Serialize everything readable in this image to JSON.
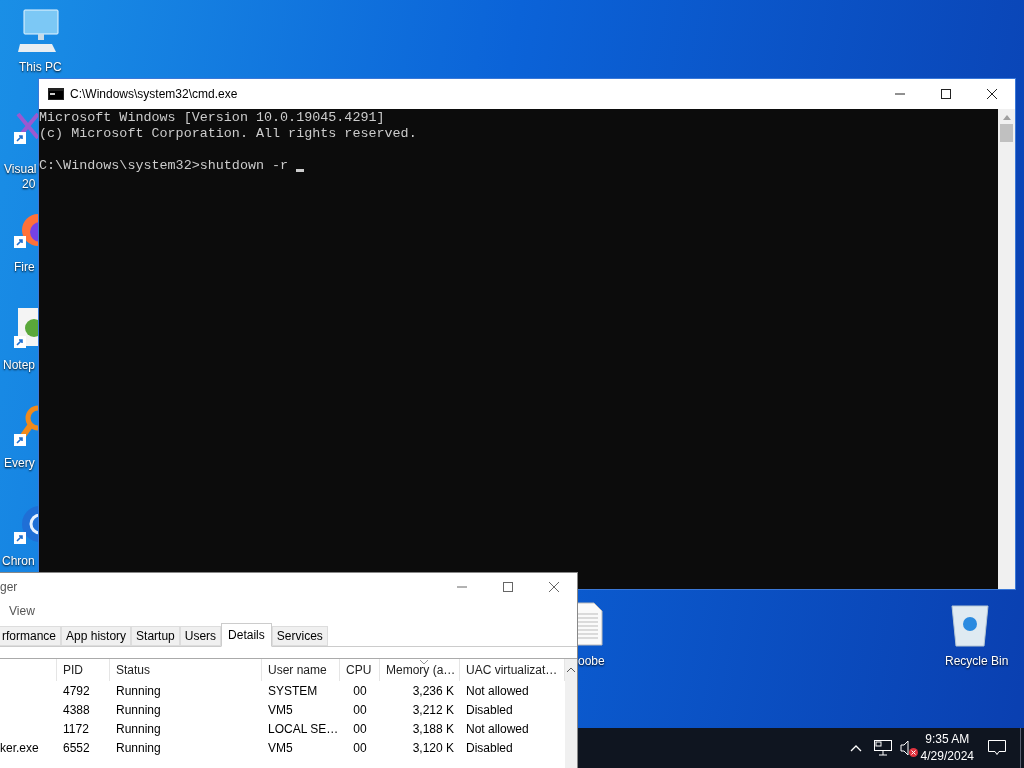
{
  "desktop": {
    "icons": [
      {
        "kind": "computer",
        "label_lines": [
          "This PC"
        ],
        "shortcut": false
      },
      {
        "kind": "visual-studio",
        "label_lines": [
          "Visual",
          "20"
        ],
        "shortcut": true
      },
      {
        "kind": "firefox",
        "label_lines": [
          "Fire"
        ],
        "shortcut": true
      },
      {
        "kind": "notepad",
        "label_lines": [
          "Notep"
        ],
        "shortcut": true
      },
      {
        "kind": "everything",
        "label_lines": [
          "Every"
        ],
        "shortcut": true
      },
      {
        "kind": "chrome",
        "label_lines": [
          "Chron"
        ],
        "shortcut": true
      },
      {
        "kind": "document",
        "label_lines": [
          "oobe"
        ],
        "shortcut": false
      },
      {
        "kind": "recycle-bin",
        "label_lines": [
          "Recycle Bin"
        ],
        "shortcut": false
      }
    ]
  },
  "cmd_window": {
    "title": "C:\\Windows\\system32\\cmd.exe",
    "banner_lines": [
      "Microsoft Windows [Version 10.0.19045.4291]",
      "(c) Microsoft Corporation. All rights reserved."
    ],
    "prompt_line": "C:\\Windows\\system32>shutdown -r "
  },
  "task_manager": {
    "title": "ger",
    "menu": [
      "View"
    ],
    "tabs": [
      {
        "label": "rformance",
        "selected": false
      },
      {
        "label": "App history",
        "selected": false
      },
      {
        "label": "Startup",
        "selected": false
      },
      {
        "label": "Users",
        "selected": false
      },
      {
        "label": "Details",
        "selected": true
      },
      {
        "label": "Services",
        "selected": false
      }
    ],
    "columns": [
      {
        "label": "PID",
        "sorted": false
      },
      {
        "label": "Status",
        "sorted": false
      },
      {
        "label": "User name",
        "sorted": false
      },
      {
        "label": "CPU",
        "sorted": false
      },
      {
        "label": "Memory (a…",
        "sorted": true
      },
      {
        "label": "UAC virtualizat…",
        "sorted": false
      }
    ],
    "rows": [
      {
        "cells": [
          "4792",
          "Running",
          "SYSTEM",
          "00",
          "3,236 K",
          "Not allowed"
        ]
      },
      {
        "cells": [
          "4388",
          "Running",
          "VM5",
          "00",
          "3,212 K",
          "Disabled"
        ]
      },
      {
        "cells": [
          "1172",
          "Running",
          "LOCAL SE…",
          "00",
          "3,188 K",
          "Not allowed"
        ]
      },
      {
        "name": "ker.exe",
        "cells": [
          "6552",
          "Running",
          "VM5",
          "00",
          "3,120 K",
          "Disabled"
        ]
      }
    ]
  },
  "taskbar": {
    "volume_muted": true,
    "time": "9:35 AM",
    "date": "4/29/2024"
  }
}
